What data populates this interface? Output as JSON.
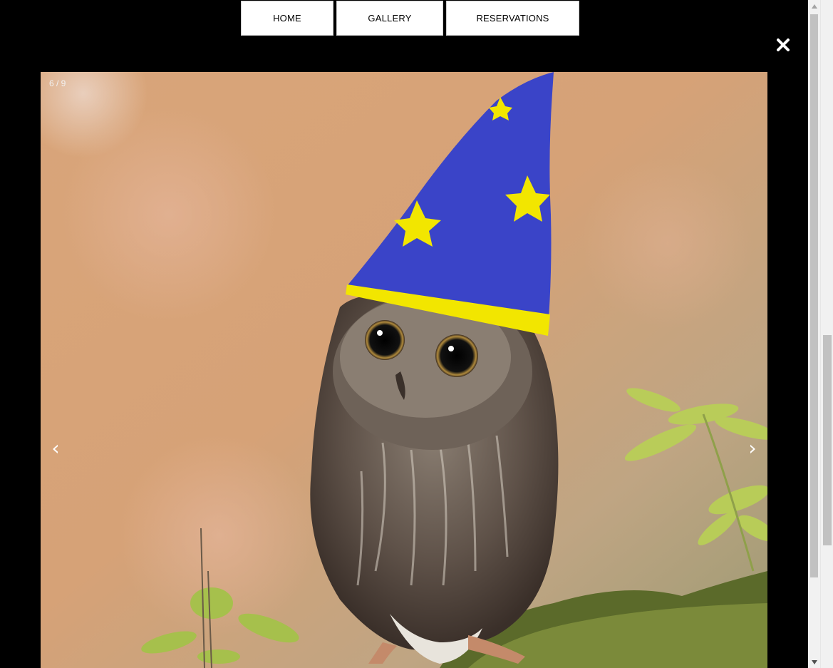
{
  "nav": {
    "home_label": "HOME",
    "gallery_label": "GALLERY",
    "reservations_label": "RESERVATIONS"
  },
  "lightbox": {
    "counter": "6 / 9",
    "close_icon": "close-icon",
    "prev_icon": "chevron-left-icon",
    "next_icon": "chevron-right-icon",
    "prev_glyph": "‹",
    "next_glyph": "›",
    "image_subject": "owl wearing a wizard hat"
  },
  "colors": {
    "overlay": "#000000",
    "hat": "#3a44c8",
    "hat_stars": "#f2e600",
    "nav_button_bg": "#ffffff"
  }
}
